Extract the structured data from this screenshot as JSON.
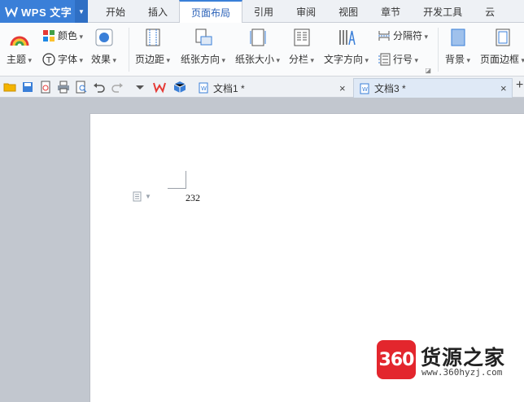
{
  "app": {
    "title": "WPS 文字",
    "accent": "#3a7fd8"
  },
  "menu": {
    "tabs": [
      {
        "label": "开始"
      },
      {
        "label": "插入"
      },
      {
        "label": "页面布局",
        "active": true
      },
      {
        "label": "引用"
      },
      {
        "label": "审阅"
      },
      {
        "label": "视图"
      },
      {
        "label": "章节"
      },
      {
        "label": "开发工具"
      },
      {
        "label": "云"
      }
    ]
  },
  "ribbon": {
    "theme": "主题",
    "color": "颜色",
    "font": "字体",
    "effect": "效果",
    "margin": "页边距",
    "orientation": "纸张方向",
    "size": "纸张大小",
    "columns": "分栏",
    "text_direction": "文字方向",
    "separator": "分隔符",
    "line_numbers": "行号",
    "background": "背景",
    "page_border": "页面边框"
  },
  "doc_tabs": [
    {
      "label": "文档1 *",
      "active": false
    },
    {
      "label": "文档3 *",
      "active": true
    }
  ],
  "document": {
    "text": "232"
  },
  "watermark": {
    "badge": "360",
    "name": "货源之家",
    "url": "www.360hyzj.com"
  }
}
